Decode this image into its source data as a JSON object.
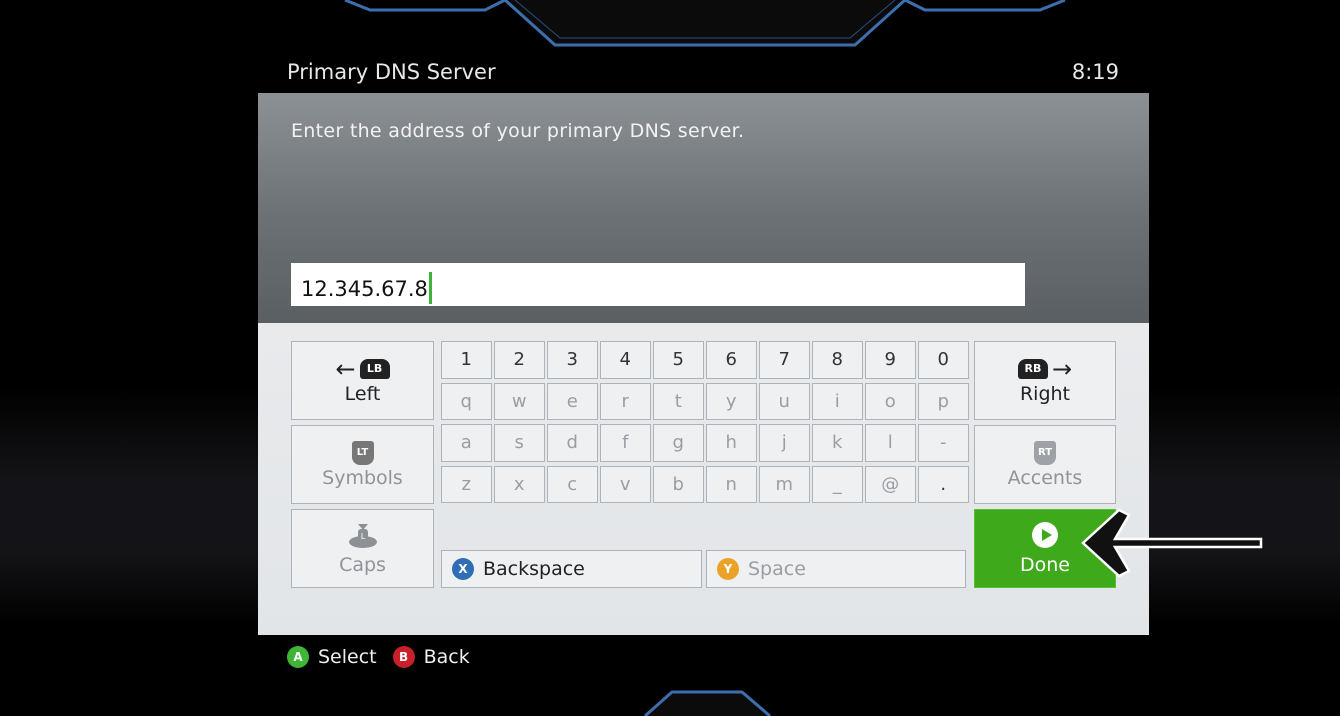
{
  "header": {
    "title": "Primary DNS Server",
    "clock": "8:19"
  },
  "dialog": {
    "prompt": "Enter the address of your primary DNS server.",
    "input_value": "12.345.67.8"
  },
  "keyboard": {
    "rows": [
      [
        "1",
        "2",
        "3",
        "4",
        "5",
        "6",
        "7",
        "8",
        "9",
        "0"
      ],
      [
        "q",
        "w",
        "e",
        "r",
        "t",
        "y",
        "u",
        "i",
        "o",
        "p"
      ],
      [
        "a",
        "s",
        "d",
        "f",
        "g",
        "h",
        "j",
        "k",
        "l",
        "-"
      ],
      [
        "z",
        "x",
        "c",
        "v",
        "b",
        "n",
        "m",
        "_",
        "@",
        "."
      ]
    ],
    "left": {
      "badge": "LB",
      "label": "Left"
    },
    "right": {
      "badge": "RB",
      "label": "Right"
    },
    "symbols": {
      "badge": "LT",
      "label": "Symbols"
    },
    "accents": {
      "badge": "RT",
      "label": "Accents"
    },
    "caps": {
      "badge": "L",
      "label": "Caps"
    },
    "backspace": {
      "badge": "X",
      "label": "Backspace"
    },
    "space": {
      "badge": "Y",
      "label": "Space"
    },
    "done": {
      "label": "Done"
    }
  },
  "footer": {
    "select": {
      "badge": "A",
      "label": "Select"
    },
    "back": {
      "badge": "B",
      "label": "Back"
    }
  },
  "colors": {
    "a_button": "#3fb536",
    "b_button": "#c8202a",
    "x_button": "#2f6db5",
    "y_button": "#eaa22b",
    "done_green": "#3ea91b"
  }
}
